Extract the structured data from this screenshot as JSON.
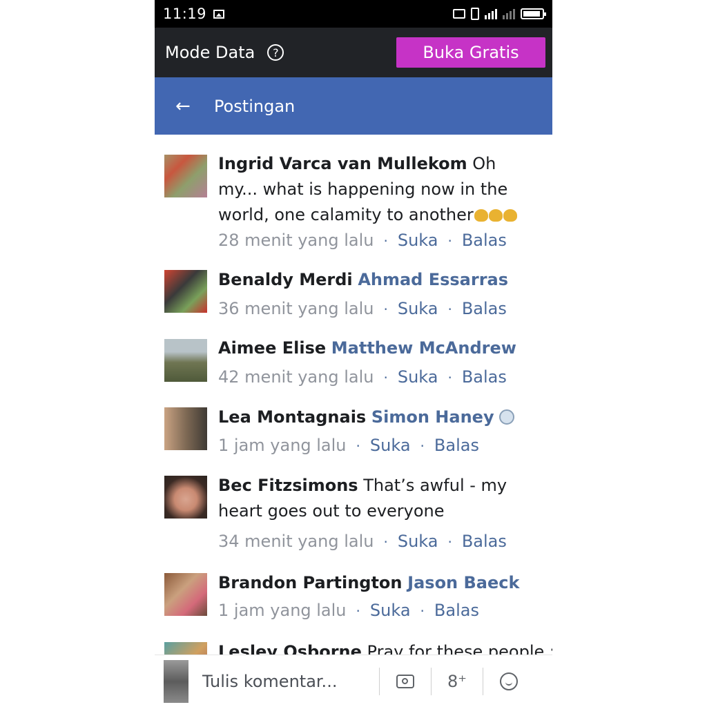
{
  "statusbar": {
    "time": "11:19"
  },
  "databar": {
    "mode_label": "Mode Data",
    "help_glyph": "?",
    "free_button": "Buka Gratis"
  },
  "header": {
    "back_glyph": "←",
    "title": "Postingan"
  },
  "comments": [
    {
      "author": "Ingrid Varca van Mullekom",
      "text": " Oh my... what is happening now in the world, one calamity to another",
      "mention": "",
      "time": "28 menit yang lalu",
      "like": "Suka",
      "reply": "Balas"
    },
    {
      "author": "Benaldy Merdi",
      "text": "",
      "mention": "Ahmad Essarras",
      "time": "36 menit yang lalu",
      "like": "Suka",
      "reply": "Balas"
    },
    {
      "author": "Aimee Elise",
      "text": "",
      "mention": "Matthew McAndrew",
      "time": "42 menit yang lalu",
      "like": "Suka",
      "reply": "Balas"
    },
    {
      "author": "Lea Montagnais",
      "text": "",
      "mention": "Simon Haney",
      "time": "1 jam yang lalu",
      "like": "Suka",
      "reply": "Balas"
    },
    {
      "author": "Bec Fitzsimons",
      "text": " That’s awful - my heart goes out to everyone",
      "mention": "",
      "time": "34 menit yang lalu",
      "like": "Suka",
      "reply": "Balas"
    },
    {
      "author": "Brandon Partington",
      "text": "",
      "mention": "Jason Baeck",
      "time": "1 jam yang lalu",
      "like": "Suka",
      "reply": "Balas"
    },
    {
      "author": "Lesley Osborne",
      "text": " Pray for these people :",
      "mention": "",
      "time": "",
      "like": "",
      "reply": ""
    }
  ],
  "composer": {
    "placeholder": "Tulis komentar...",
    "tag_glyph": "8⁺"
  },
  "meta_separator": "·"
}
